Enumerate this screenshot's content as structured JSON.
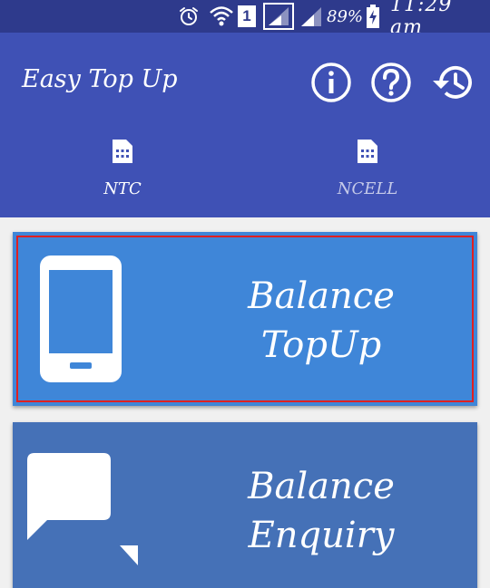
{
  "status_bar": {
    "battery_percent": "89%",
    "time": "11:29 am",
    "sim_number": "1",
    "icons": [
      "alarm-icon",
      "wifi-icon",
      "sim-1-icon",
      "signal-sim1-icon",
      "signal-sim2-icon",
      "battery-charging-icon"
    ]
  },
  "app_bar": {
    "title": "Easy Top Up",
    "actions": [
      "info-icon",
      "help-icon",
      "history-icon"
    ]
  },
  "tabs": [
    {
      "label": "NTC",
      "icon": "sim-card-icon",
      "selected": true
    },
    {
      "label": "NCELL",
      "icon": "sim-card-icon",
      "selected": false
    }
  ],
  "cards": [
    {
      "line1": "Balance",
      "line2": "TopUp",
      "icon": "smartphone-icon",
      "color": "#3f86d8",
      "focused": true
    },
    {
      "line1": "Balance",
      "line2": "Enquiry",
      "icon": "chat-bubbles-icon",
      "color": "#4571b7",
      "focused": false
    }
  ],
  "colors": {
    "primary": "#3f51b5",
    "primary_dark": "#2e3a8c",
    "tab_inactive_text": "#c5cae9",
    "focus_border": "#e02020"
  }
}
